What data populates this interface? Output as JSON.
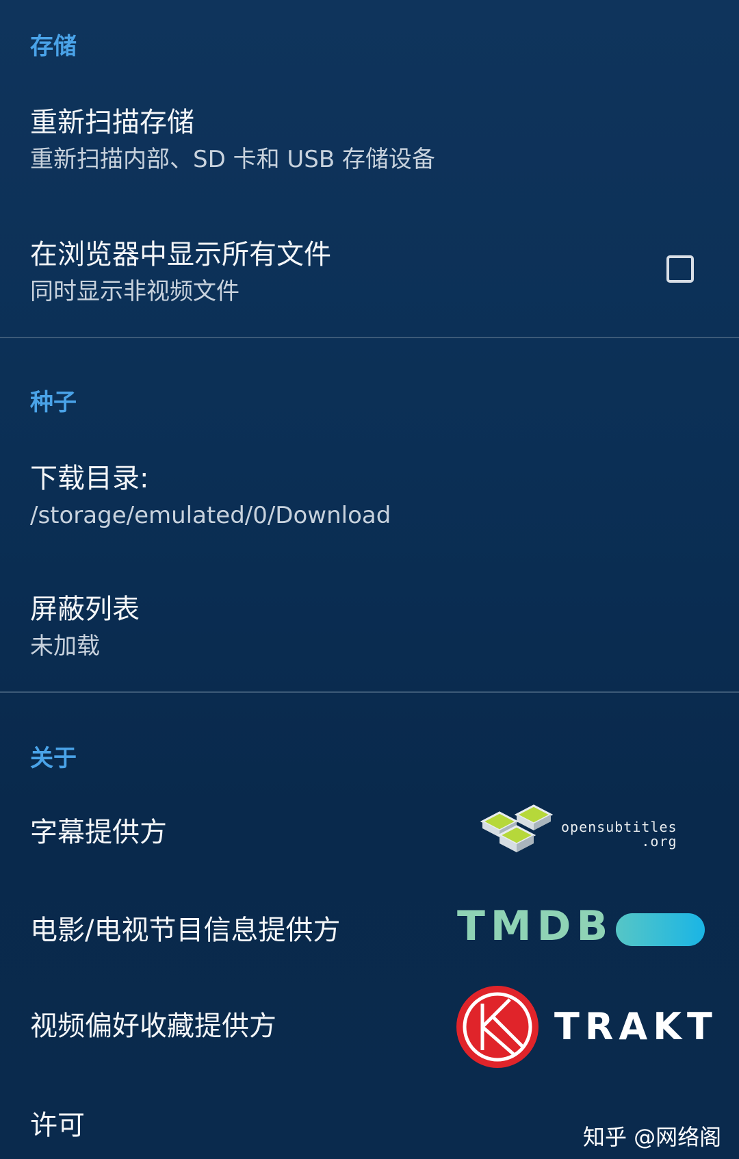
{
  "sections": {
    "storage": {
      "header": "存储",
      "rescan": {
        "title": "重新扫描存储",
        "subtitle": "重新扫描内部、SD 卡和 USB 存储设备"
      },
      "show_all": {
        "title": "在浏览器中显示所有文件",
        "subtitle": "同时显示非视频文件",
        "checked": false
      }
    },
    "torrent": {
      "header": "种子",
      "download_dir": {
        "title": "下载目录:",
        "subtitle": "/storage/emulated/0/Download"
      },
      "blocklist": {
        "title": "屏蔽列表",
        "subtitle": "未加载"
      }
    },
    "about": {
      "header": "关于",
      "subtitle_provider": {
        "title": "字幕提供方",
        "logo_text_1": "opensubtitles",
        "logo_text_2": ".org"
      },
      "metadata_provider": {
        "title": "电影/电视节目信息提供方",
        "logo_text": "TMDB"
      },
      "favorites_provider": {
        "title": "视频偏好收藏提供方",
        "logo_text": "TRAKT"
      },
      "license": {
        "title": "许可"
      }
    }
  },
  "watermark": "知乎 @网络阁",
  "colors": {
    "accent": "#4aa3e8",
    "background": "#0b2f55",
    "trakt_red": "#e0242a",
    "tmdb_blue": "#1ab5e5",
    "tmdb_green": "#8fd3b5"
  }
}
